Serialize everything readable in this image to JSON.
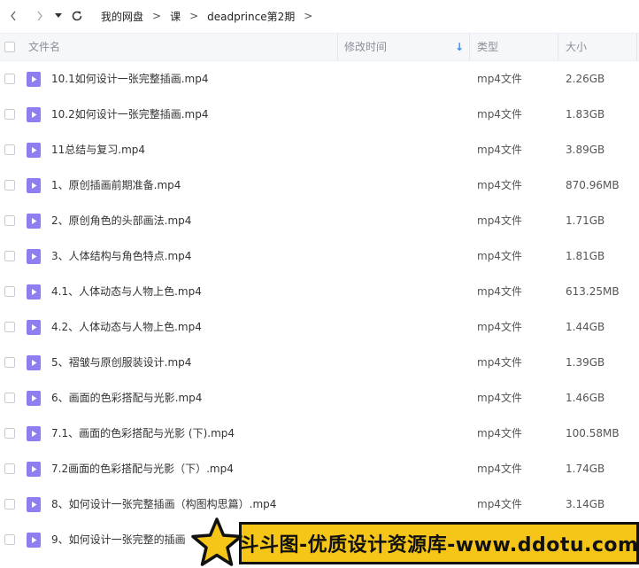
{
  "nav": {
    "back_icon": "chevron-left-icon",
    "forward_icon": "chevron-right-icon",
    "history_icon": "caret-down-icon",
    "refresh_icon": "refresh-icon"
  },
  "breadcrumb": [
    {
      "label": "我的网盘"
    },
    {
      "label": "课"
    },
    {
      "label": "deadprince第2期"
    }
  ],
  "breadcrumb_sep": ">",
  "columns": {
    "name": "文件名",
    "modified": "修改时间",
    "type": "类型",
    "size": "大小",
    "sort_indicator": "↓"
  },
  "files": [
    {
      "name": "10.1如何设计一张完整插画.mp4",
      "type": "mp4文件",
      "size": "2.26GB"
    },
    {
      "name": "10.2如何设计一张完整插画.mp4",
      "type": "mp4文件",
      "size": "1.83GB"
    },
    {
      "name": "11总结与复习.mp4",
      "type": "mp4文件",
      "size": "3.89GB"
    },
    {
      "name": "1、原创插画前期准备.mp4",
      "type": "mp4文件",
      "size": "870.96MB"
    },
    {
      "name": "2、原创角色的头部画法.mp4",
      "type": "mp4文件",
      "size": "1.71GB"
    },
    {
      "name": "3、人体结构与角色特点.mp4",
      "type": "mp4文件",
      "size": "1.81GB"
    },
    {
      "name": "4.1、人体动态与人物上色.mp4",
      "type": "mp4文件",
      "size": "613.25MB"
    },
    {
      "name": "4.2、人体动态与人物上色.mp4",
      "type": "mp4文件",
      "size": "1.44GB"
    },
    {
      "name": "5、褶皱与原创服装设计.mp4",
      "type": "mp4文件",
      "size": "1.39GB"
    },
    {
      "name": "6、画面的色彩搭配与光影.mp4",
      "type": "mp4文件",
      "size": "1.46GB"
    },
    {
      "name": "7.1、画面的色彩搭配与光影 (下).mp4",
      "type": "mp4文件",
      "size": "100.58MB"
    },
    {
      "name": "7.2画面的色彩搭配与光影（下）.mp4",
      "type": "mp4文件",
      "size": "1.74GB"
    },
    {
      "name": "8、如何设计一张完整插画（构图构思篇）.mp4",
      "type": "mp4文件",
      "size": "3.14GB"
    },
    {
      "name": "9、如何设计一张完整的插画",
      "type": "",
      "size": ""
    }
  ],
  "file_icon": "video-file-icon",
  "watermark": {
    "text": "斗斗图-优质设计资源库-www.ddotu.com",
    "icon": "star-icon",
    "bg_color": "#f5c518"
  },
  "colors": {
    "file_icon": "#8e7ff0",
    "header_bg": "#f6f7f9",
    "sort_arrow": "#3a8bf0"
  }
}
